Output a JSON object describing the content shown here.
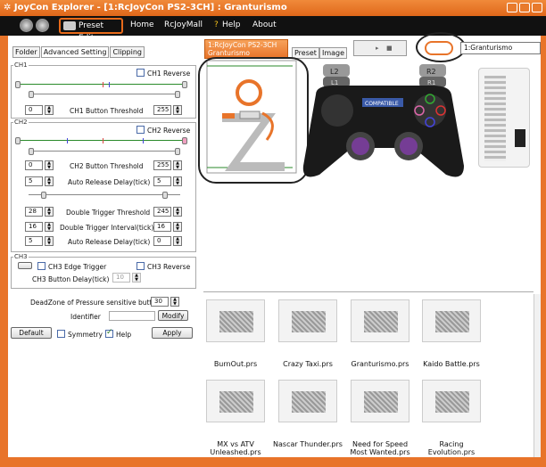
{
  "window": {
    "title": "JoyCon Explorer - [1:RcJoyCon PS2-3CH] : Granturismo"
  },
  "menu": {
    "preset_edit": "Preset Edit",
    "home": "Home",
    "rcjoymall": "RcJoyMall",
    "help": "Help",
    "about": "About"
  },
  "tabs": {
    "folder": "Folder",
    "advanced": "Advanced Setting",
    "clipping": "Clipping"
  },
  "ch1": {
    "legend": "CH1",
    "reverse": "CH1 Reverse",
    "thr_label": "CH1 Button Threshold",
    "thr_low": "0",
    "thr_high": "255"
  },
  "ch2": {
    "legend": "CH2",
    "reverse": "CH2 Reverse",
    "thr_label": "CH2 Button Threshold",
    "thr_low": "0",
    "thr_high": "255",
    "ard_label": "Auto Release Delay(tick)",
    "ard_low": "5",
    "ard_high": "5",
    "dtt_label": "Double Trigger Threshold",
    "dtt_low": "28",
    "dtt_high": "245",
    "dti_label": "Double Trigger Interval(tick)",
    "dti_low": "16",
    "dti_high": "16",
    "ard2_label": "Auto Release Delay(tick)",
    "ard2_low": "5",
    "ard2_high": "0"
  },
  "ch3": {
    "legend": "CH3",
    "edge": "CH3 Edge Trigger",
    "reverse": "CH3 Reverse",
    "delay_label": "CH3 Button Delay(tick)",
    "delay": "10"
  },
  "deadzone": {
    "label": "DeadZone of Pressure sensitive button",
    "value": "30"
  },
  "identifier": {
    "label": "Identifier",
    "value": "",
    "modify": "Modify"
  },
  "bottom_controls": {
    "default": "Default",
    "symmetry": "Symmetry",
    "help": "Help",
    "apply": "Apply"
  },
  "content": {
    "device_tab_line1": "1:RcJoyCon PS2-3CH",
    "device_tab_line2": "Granturismo",
    "preset_tab": "Preset",
    "image_tab": "Image",
    "preset_combo": "1:Granturismo",
    "gamepad_badge": "COMPATIBLE",
    "l2": "L2",
    "l1": "L1",
    "r2": "R2",
    "r1": "R1"
  },
  "presets": [
    {
      "name": "BurnOut.prs"
    },
    {
      "name": "Crazy Taxi.prs"
    },
    {
      "name": "Granturismo.prs"
    },
    {
      "name": "Kaido Battle.prs"
    },
    {
      "name": "MX vs ATV Unleashed.prs"
    },
    {
      "name": "Nascar Thunder.prs"
    },
    {
      "name": "Need for Speed Most Wanted.prs"
    },
    {
      "name": "Racing Evolution.prs"
    }
  ],
  "colors": {
    "accent": "#e8742a",
    "menubar": "#111111"
  }
}
